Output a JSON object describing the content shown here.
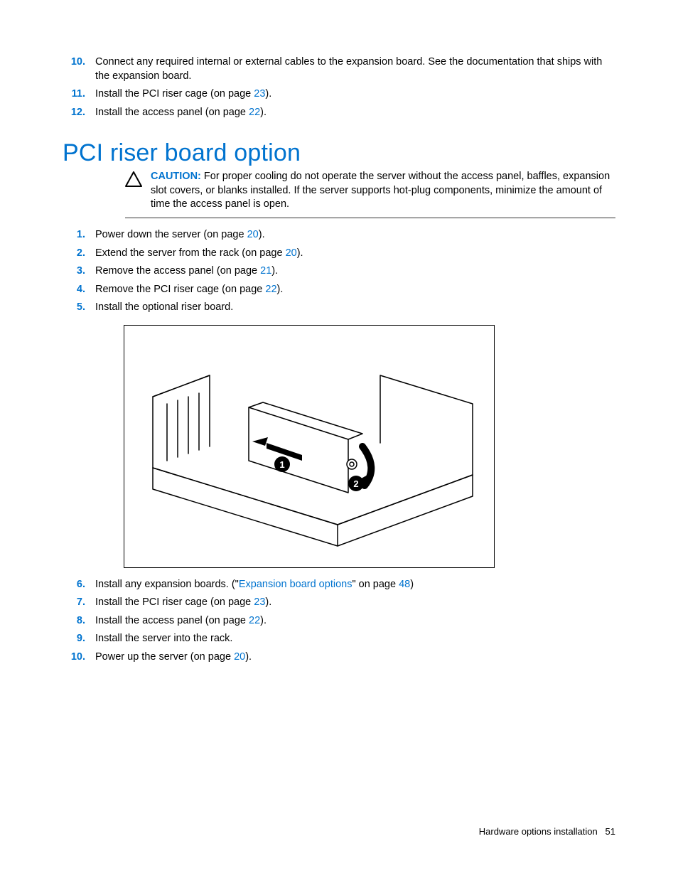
{
  "topList": [
    {
      "n": "10.",
      "text_a": "Connect any required internal or external cables to the expansion board. See the documentation that ships with the expansion board."
    },
    {
      "n": "11.",
      "text_a": "Install the PCI riser cage (on page ",
      "link": "23",
      "text_b": ")."
    },
    {
      "n": "12.",
      "text_a": "Install the access panel (on page ",
      "link": "22",
      "text_b": ")."
    }
  ],
  "heading": "PCI riser board option",
  "caution": {
    "label": "CAUTION:",
    "text": " For proper cooling do not operate the server without the access panel, baffles, expansion slot covers, or blanks installed. If the server supports hot-plug components, minimize the amount of time the access panel is open."
  },
  "mainList": [
    {
      "n": "1.",
      "text_a": "Power down the server (on page ",
      "link": "20",
      "text_b": ")."
    },
    {
      "n": "2.",
      "text_a": "Extend the server from the rack (on page ",
      "link": "20",
      "text_b": ")."
    },
    {
      "n": "3.",
      "text_a": "Remove the access panel (on page ",
      "link": "21",
      "text_b": ")."
    },
    {
      "n": "4.",
      "text_a": "Remove the PCI riser cage (on page ",
      "link": "22",
      "text_b": ")."
    },
    {
      "n": "5.",
      "text_a": "Install the optional riser board."
    }
  ],
  "figure": {
    "callouts": [
      "1",
      "2"
    ],
    "alt": "Server chassis illustration — PCI riser board installation (callouts 1 and 2 with arrows)"
  },
  "afterList": [
    {
      "n": "6.",
      "text_a": "Install any expansion boards. (\"",
      "link1": "Expansion board options",
      "mid": "\" on page ",
      "link2": "48",
      "text_b": ")"
    },
    {
      "n": "7.",
      "text_a": "Install the PCI riser cage (on page ",
      "link": "23",
      "text_b": ")."
    },
    {
      "n": "8.",
      "text_a": "Install the access panel (on page ",
      "link": "22",
      "text_b": ")."
    },
    {
      "n": "9.",
      "text_a": "Install the server into the rack."
    },
    {
      "n": "10.",
      "text_a": "Power up the server (on page ",
      "link": "20",
      "text_b": ")."
    }
  ],
  "footer": {
    "section": "Hardware options installation",
    "page": "51"
  }
}
